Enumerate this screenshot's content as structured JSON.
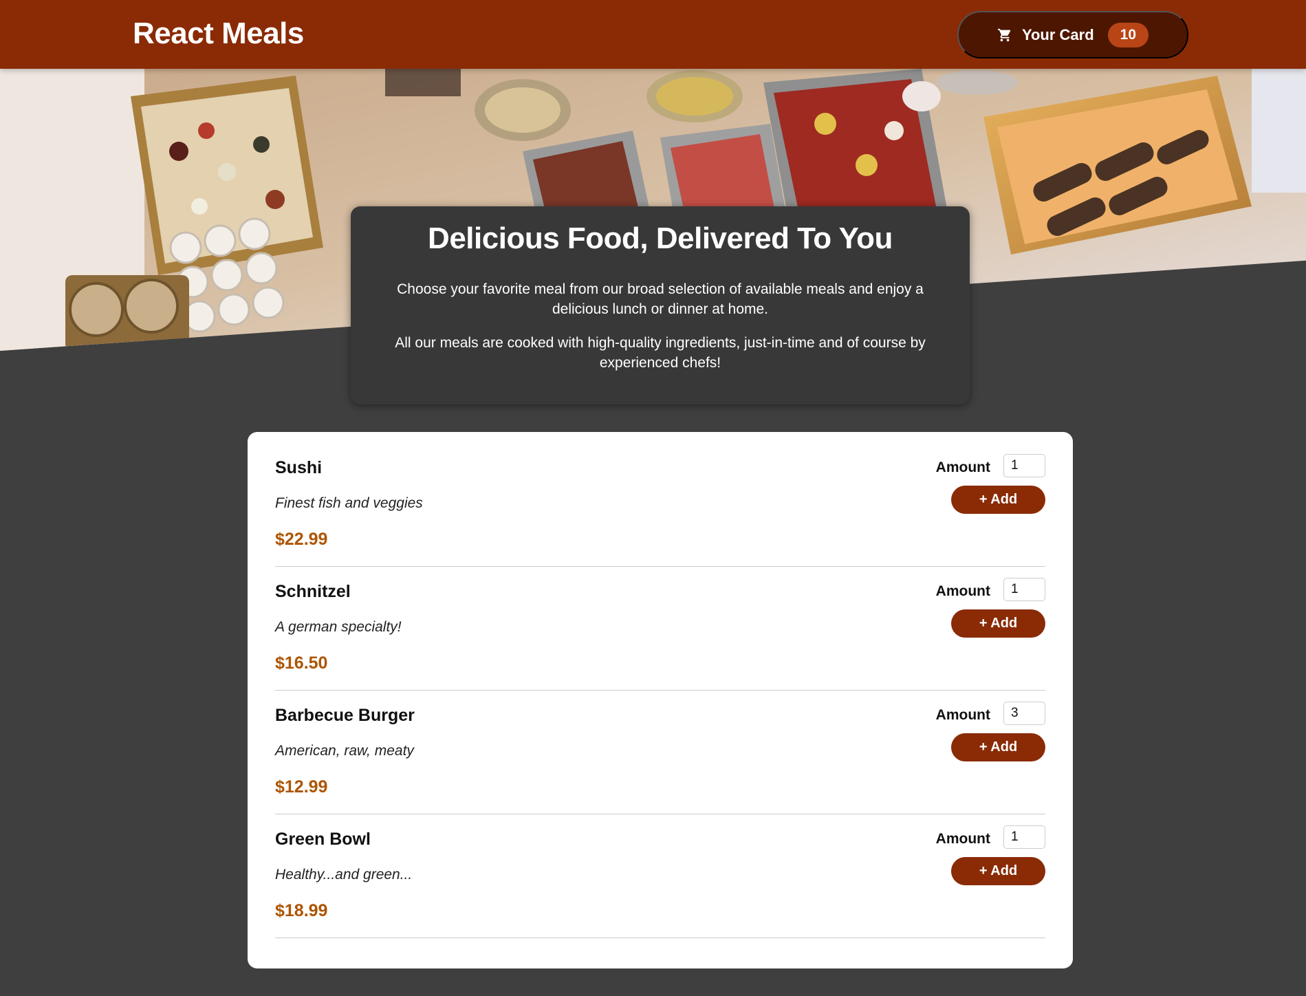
{
  "header": {
    "brand": "React Meals",
    "cart": {
      "icon": "cart-icon",
      "label": "Your Card",
      "count": "10"
    }
  },
  "summary": {
    "title": "Delicious Food, Delivered To You",
    "paragraph1": "Choose your favorite meal from our broad selection of available meals and enjoy a delicious lunch or dinner at home.",
    "paragraph2": "All our meals are cooked with high-quality ingredients, just-in-time and of course by experienced chefs!"
  },
  "meals": {
    "amount_label": "Amount",
    "add_label": "+ Add",
    "items": [
      {
        "name": "Sushi",
        "description": "Finest fish and veggies",
        "price": "$22.99",
        "amount": "1"
      },
      {
        "name": "Schnitzel",
        "description": "A german specialty!",
        "price": "$16.50",
        "amount": "1"
      },
      {
        "name": "Barbecue Burger",
        "description": "American, raw, meaty",
        "price": "$12.99",
        "amount": "3"
      },
      {
        "name": "Green Bowl",
        "description": "Healthy...and green...",
        "price": "$18.99",
        "amount": "1"
      }
    ]
  },
  "colors": {
    "header_bg": "#8a2b06",
    "cart_button_bg": "#4d1601",
    "cart_badge_bg": "#b94517",
    "page_bg": "#3f3f3f",
    "summary_bg": "#383838",
    "price": "#ad5502",
    "add_button_bg": "#8a2b06"
  }
}
